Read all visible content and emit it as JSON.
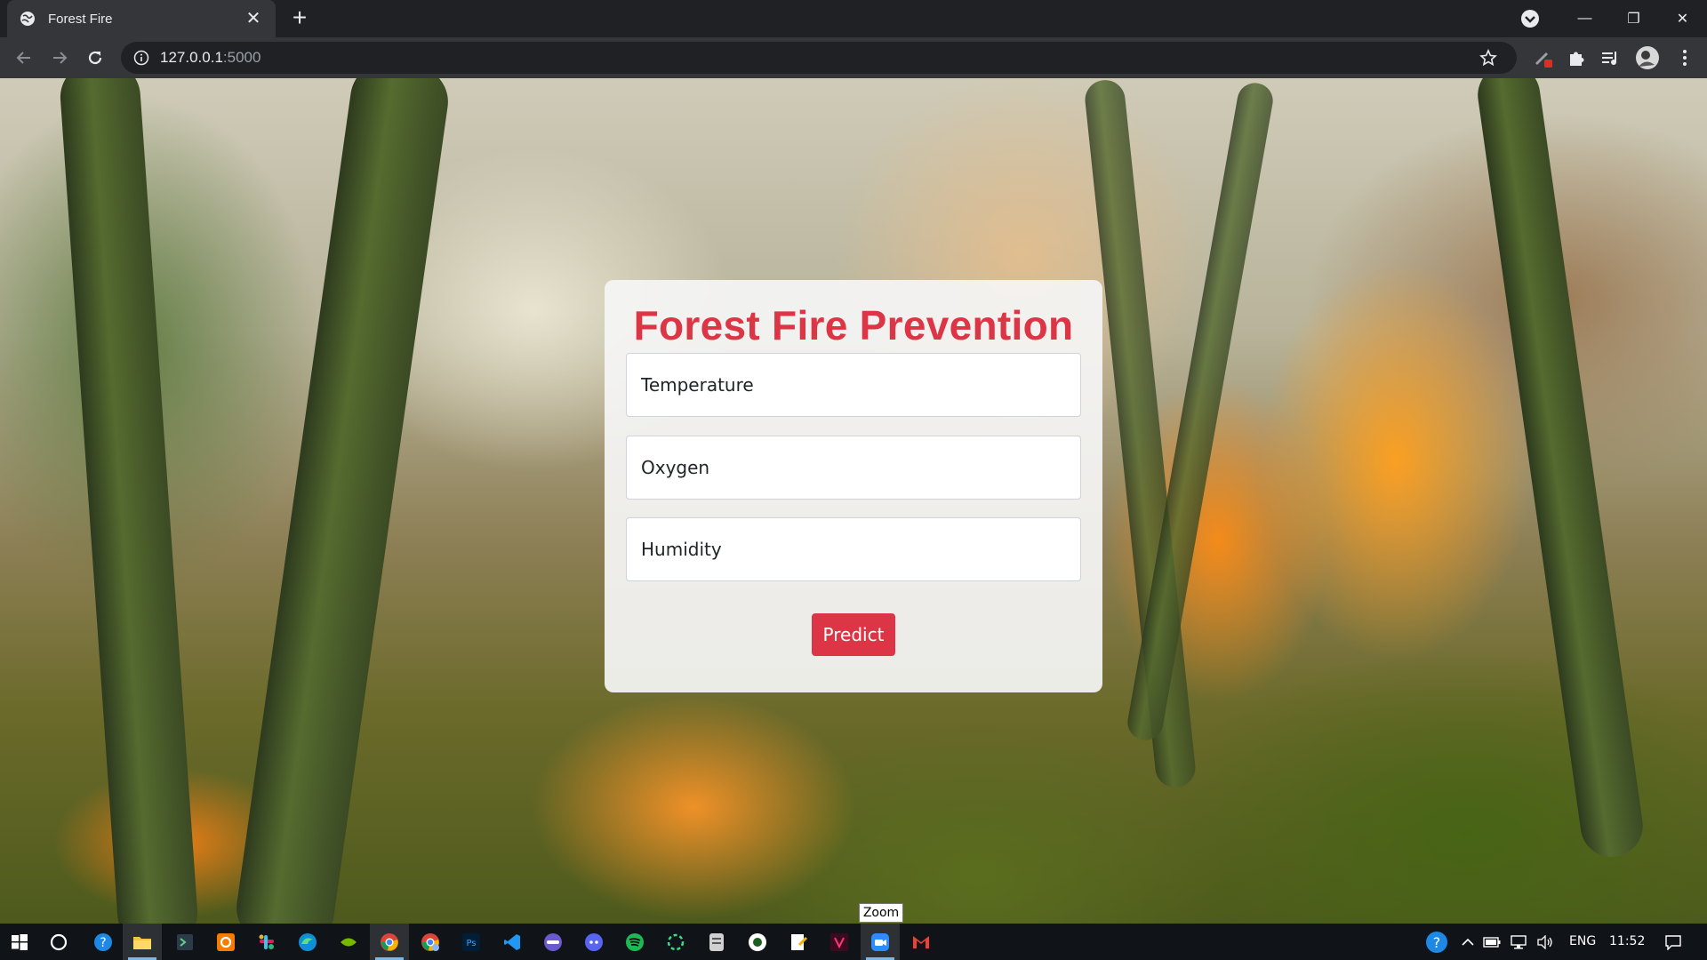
{
  "browser": {
    "tab_title": "Forest Fire",
    "tab_close": "✕",
    "new_tab": "+",
    "url_host": "127.0.0.1",
    "url_port": ":5000",
    "window_controls": {
      "minimize": "—",
      "restore": "❐",
      "close": "✕"
    }
  },
  "page": {
    "title": "Forest Fire Prevention",
    "fields": {
      "temperature_placeholder": "Temperature",
      "oxygen_placeholder": "Oxygen",
      "humidity_placeholder": "Humidity"
    },
    "predict_label": "Predict"
  },
  "tooltip": {
    "text": "Zoom"
  },
  "taskbar": {
    "apps": [
      "start",
      "cortana",
      "help",
      "file-explorer",
      "powershell",
      "quickbooks",
      "slack",
      "edge",
      "nvidia",
      "chrome",
      "chrome-alt",
      "photoshop",
      "vscode",
      "app",
      "discord",
      "spotify",
      "app-green",
      "files",
      "app-dot",
      "notepad",
      "app-v",
      "zoom",
      "gmail"
    ],
    "language": "ENG",
    "time": "11:52"
  },
  "colors": {
    "accent": "#dc3545",
    "chrome_dark": "#202124",
    "chrome_tab": "#35363a",
    "taskbar": "#101418"
  }
}
